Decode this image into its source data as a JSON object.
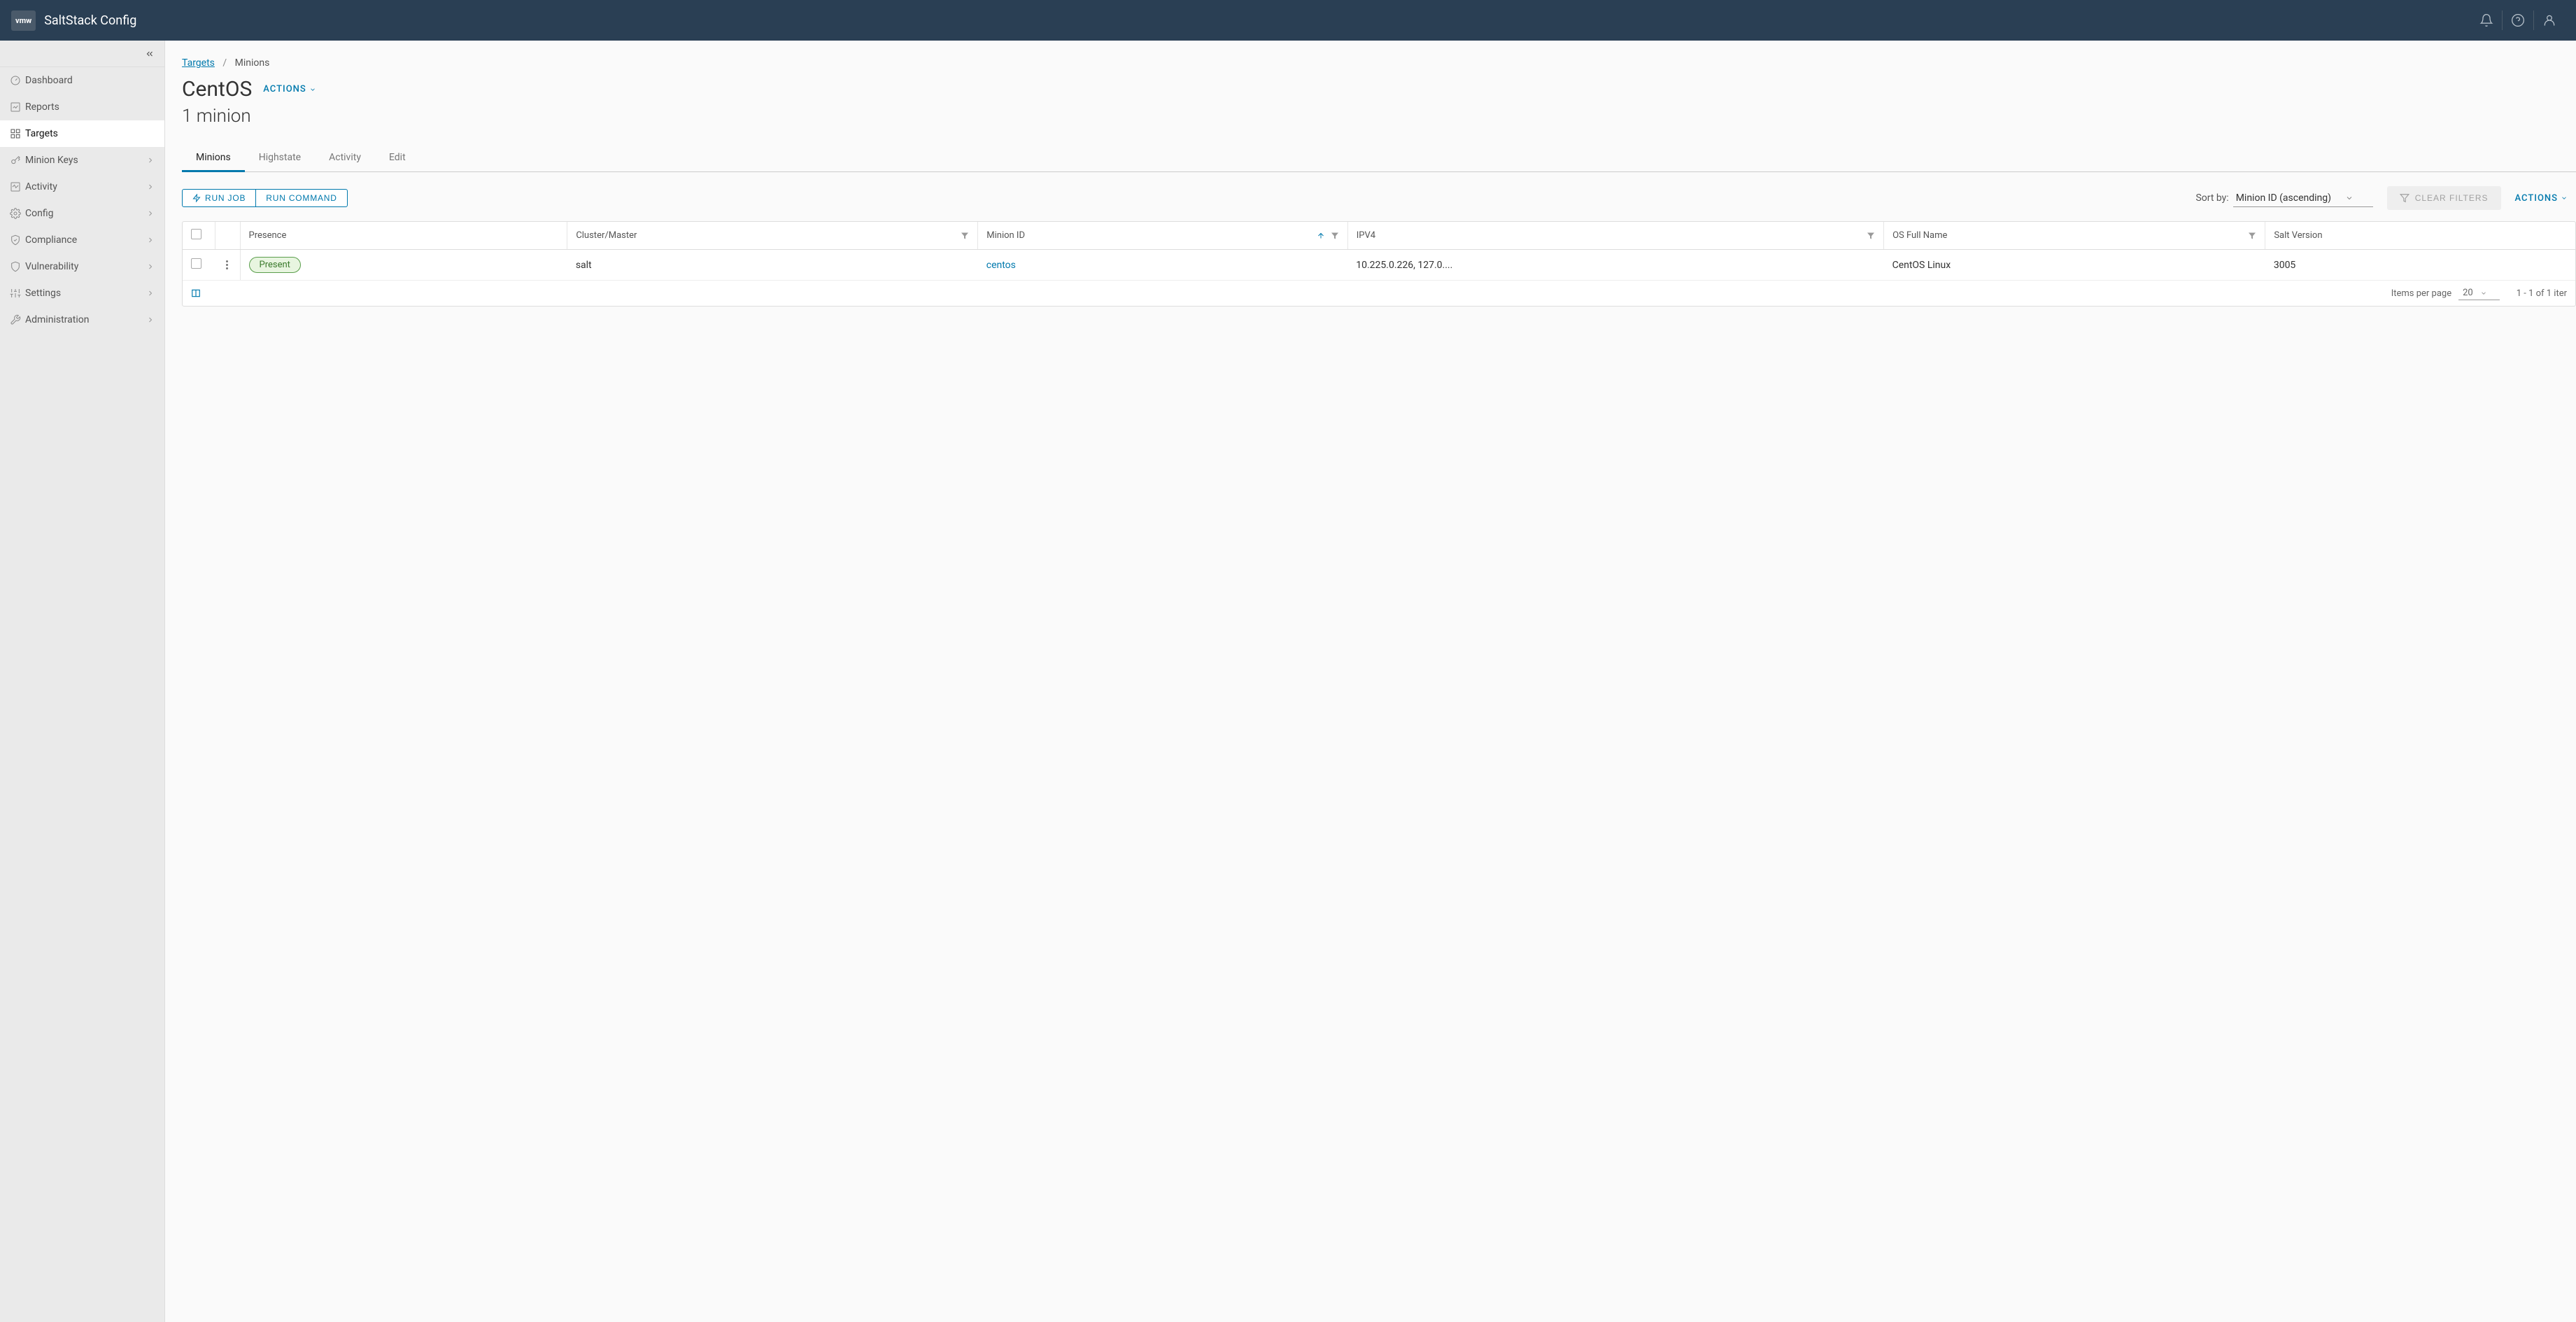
{
  "header": {
    "logo": "vmw",
    "title": "SaltStack Config"
  },
  "sidebar": {
    "items": [
      {
        "label": "Dashboard",
        "icon": "gauge",
        "expandable": false
      },
      {
        "label": "Reports",
        "icon": "chart",
        "expandable": false
      },
      {
        "label": "Targets",
        "icon": "grid",
        "expandable": false,
        "active": true
      },
      {
        "label": "Minion Keys",
        "icon": "key",
        "expandable": true
      },
      {
        "label": "Activity",
        "icon": "activity",
        "expandable": true
      },
      {
        "label": "Config",
        "icon": "gear",
        "expandable": true
      },
      {
        "label": "Compliance",
        "icon": "shield",
        "expandable": true
      },
      {
        "label": "Vulnerability",
        "icon": "shield",
        "expandable": true
      },
      {
        "label": "Settings",
        "icon": "sliders",
        "expandable": true
      },
      {
        "label": "Administration",
        "icon": "wrench",
        "expandable": true
      }
    ]
  },
  "breadcrumb": {
    "root": "Targets",
    "current": "Minions",
    "sep": "/"
  },
  "page": {
    "title": "CentOS",
    "actions_label": "ACTIONS",
    "subtitle": "1 minion"
  },
  "tabs": [
    {
      "label": "Minions",
      "active": true
    },
    {
      "label": "Highstate"
    },
    {
      "label": "Activity"
    },
    {
      "label": "Edit"
    }
  ],
  "toolbar": {
    "run_job": "RUN JOB",
    "run_command": "RUN COMMAND",
    "sort_label": "Sort by:",
    "sort_value": "Minion ID (ascending)",
    "clear_filters": "CLEAR FILTERS",
    "actions_label": "ACTIONS"
  },
  "table": {
    "columns": [
      {
        "label": "Presence",
        "filter": false
      },
      {
        "label": "Cluster/Master",
        "filter": true
      },
      {
        "label": "Minion ID",
        "filter": true,
        "sorted": "asc"
      },
      {
        "label": "IPV4",
        "filter": true
      },
      {
        "label": "OS Full Name",
        "filter": true
      },
      {
        "label": "Salt Version",
        "filter": false
      }
    ],
    "rows": [
      {
        "presence": "Present",
        "cluster": "salt",
        "minion_id": "centos",
        "ipv4": "10.225.0.226, 127.0....",
        "os": "CentOS Linux",
        "salt_version": "3005"
      }
    ]
  },
  "footer": {
    "items_per_page_label": "Items per page",
    "items_per_page": "20",
    "range": "1 - 1 of 1 iter"
  }
}
